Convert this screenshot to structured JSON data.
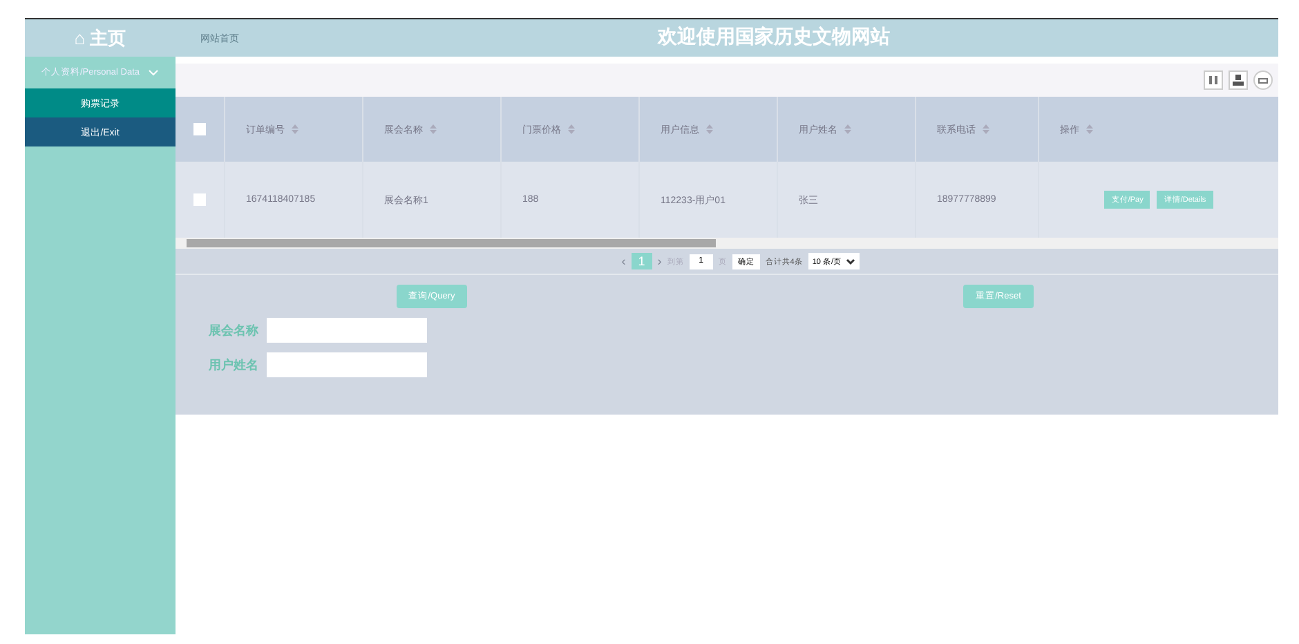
{
  "header": {
    "home": "⌂ 主页",
    "breadcrumb": "网站首页",
    "title": "欢迎使用国家历史文物网站"
  },
  "sidebar": {
    "group": {
      "label": "个人资料/Personal Data",
      "expanded": true
    },
    "items": [
      {
        "label": "购票记录",
        "kind": "item",
        "selected": true
      },
      {
        "label": "退出/Exit",
        "kind": "exit",
        "selected": false
      }
    ]
  },
  "table": {
    "select_all": {
      "checked": false
    },
    "columns": [
      "订单编号",
      "展会名称",
      "门票价格",
      "用户信息",
      "用户姓名",
      "联系电话",
      "操作"
    ],
    "rows": [
      {
        "checked": false,
        "cells": [
          "1674118407185",
          "展会名称1",
          "188",
          "112233-用户01",
          "张三",
          "18977778899"
        ],
        "actions": [
          "支付/Pay",
          "详情/Details"
        ]
      }
    ]
  },
  "pagination": {
    "prev": "‹",
    "pages": [
      {
        "label": "1",
        "selected": true
      }
    ],
    "next": "›",
    "goto_label": "到第",
    "goto_value": "1",
    "page_unit": "页",
    "confirm": "确定",
    "total": "合计共4条",
    "page_size": "10 条/页"
  },
  "search": {
    "query_button": "查询/Query",
    "reset_button": "重置/Reset",
    "fields": [
      {
        "label": "展会名称"
      },
      {
        "label": "用户姓名"
      }
    ]
  }
}
